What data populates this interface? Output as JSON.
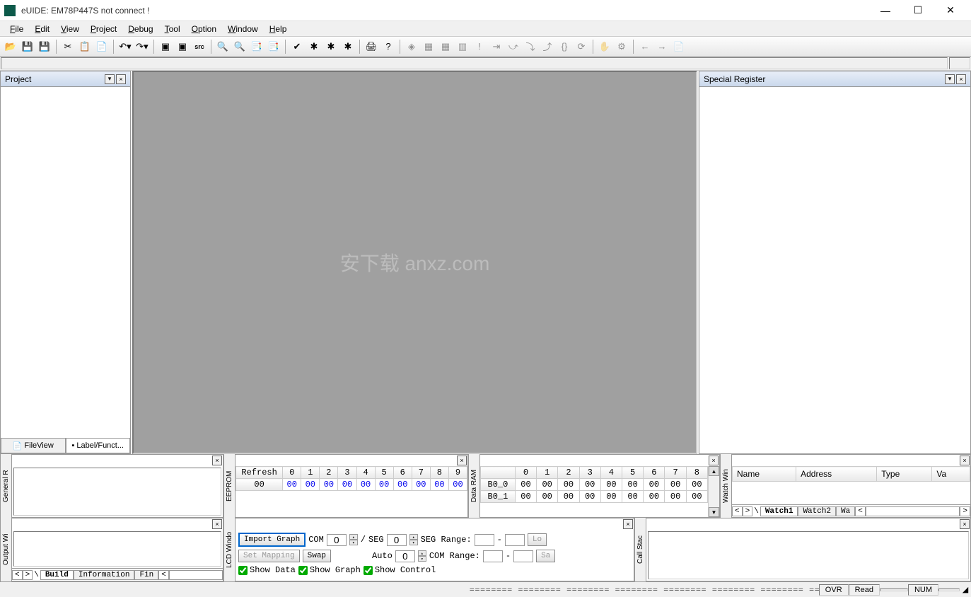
{
  "window": {
    "title": "eUIDE: EM78P447S not connect !"
  },
  "menu": {
    "file": "File",
    "edit": "Edit",
    "view": "View",
    "project": "Project",
    "debug": "Debug",
    "tool": "Tool",
    "option": "Option",
    "window": "Window",
    "help": "Help"
  },
  "panels": {
    "project": {
      "title": "Project",
      "tabs": {
        "fileview": "FileView",
        "labelfunc": "Label/Funct..."
      }
    },
    "special": {
      "title": "Special Register"
    },
    "general": {
      "label": "General R"
    },
    "eeprom": {
      "label": "EEPROM",
      "refresh": "Refresh",
      "cols": [
        "0",
        "1",
        "2",
        "3",
        "4",
        "5",
        "6",
        "7",
        "8",
        "9"
      ],
      "row0_label": "00",
      "row0": [
        "00",
        "00",
        "00",
        "00",
        "00",
        "00",
        "00",
        "00",
        "00",
        "00"
      ]
    },
    "dataram": {
      "label": "Data RAM",
      "cols": [
        "0",
        "1",
        "2",
        "3",
        "4",
        "5",
        "6",
        "7",
        "8"
      ],
      "rows": [
        {
          "label": "B0_0",
          "vals": [
            "00",
            "00",
            "00",
            "00",
            "00",
            "00",
            "00",
            "00",
            "00"
          ]
        },
        {
          "label": "B0_1",
          "vals": [
            "00",
            "00",
            "00",
            "00",
            "00",
            "00",
            "00",
            "00",
            "00"
          ]
        }
      ]
    },
    "watch": {
      "label": "Watch Win",
      "cols": {
        "name": "Name",
        "address": "Address",
        "type": "Type",
        "va": "Va"
      },
      "tabs": [
        "Watch1",
        "Watch2",
        "Wa"
      ]
    },
    "output": {
      "label": "Output Wi",
      "tabs": [
        "Build",
        "Information",
        "Fin"
      ]
    },
    "lcd": {
      "label": "LCD Windo",
      "import": "Import Graph",
      "setmapping": "Set Mapping",
      "swap": "Swap",
      "com_label": "COM",
      "com_val": "0",
      "seg_label": "SEG",
      "seg_val": "0",
      "auto_label": "Auto",
      "auto_val": "0",
      "segrange": "SEG Range:",
      "comrange": "COM Range:",
      "lo": "Lo",
      "sa": "Sa",
      "showdata": "Show Data",
      "showgraph": "Show Graph",
      "showcontrol": "Show Control"
    },
    "callstack": {
      "label": "Call Stac"
    }
  },
  "status": {
    "ovr": "OVR",
    "read": "Read",
    "num": "NUM"
  },
  "watermark": "安下载\nanxz.com"
}
